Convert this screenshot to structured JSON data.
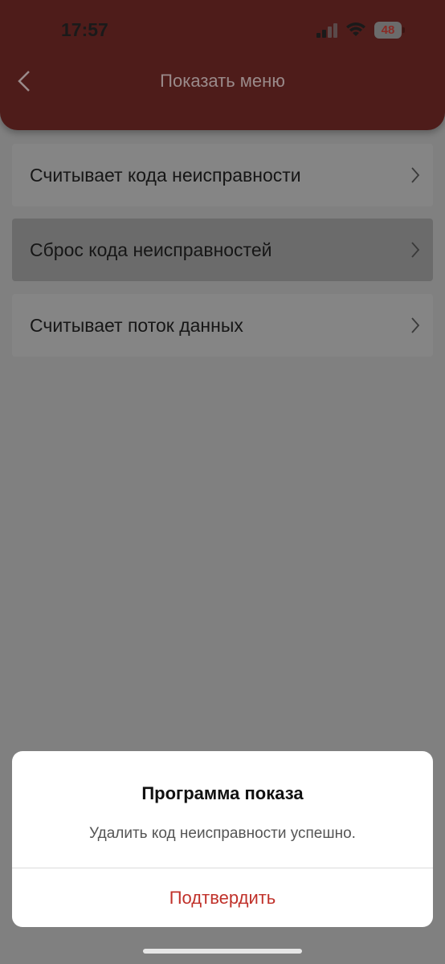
{
  "status_bar": {
    "time": "17:57",
    "battery": "48",
    "icons": [
      "signal-icon",
      "wifi-icon",
      "battery-icon"
    ]
  },
  "header": {
    "title": "Показать меню",
    "back_icon": "chevron-left-icon",
    "background": "#4e1c1a"
  },
  "menu": {
    "items": [
      {
        "label": "Считывает кода неисправности",
        "selected": false
      },
      {
        "label": "Сброс кода неисправностей",
        "selected": true
      },
      {
        "label": "Считывает поток данных",
        "selected": false
      }
    ]
  },
  "dialog": {
    "title": "Программа показа",
    "message": "Удалить код неисправности успешно.",
    "confirm_label": "Подтвердить",
    "accent_color": "#c0312a"
  }
}
